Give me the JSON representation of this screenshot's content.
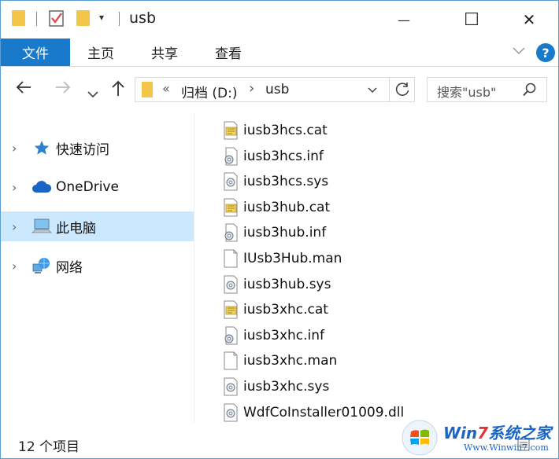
{
  "window": {
    "title": "usb",
    "minimize_glyph": "—",
    "maximize_glyph": "☐",
    "close_glyph": "✕"
  },
  "ribbon": {
    "file_tab": "文件",
    "tabs": [
      "主页",
      "共享",
      "查看"
    ],
    "help": "?"
  },
  "address": {
    "overflow": "«",
    "crumbs": [
      "归档 (D:)",
      "usb"
    ],
    "search_placeholder": "搜索\"usb\""
  },
  "sidebar": {
    "items": [
      {
        "label": "快速访问",
        "icon": "star-icon"
      },
      {
        "label": "OneDrive",
        "icon": "cloud-icon"
      },
      {
        "label": "此电脑",
        "icon": "computer-icon",
        "selected": true
      },
      {
        "label": "网络",
        "icon": "network-icon"
      }
    ]
  },
  "files": [
    {
      "name": "iusb3hcs.cat",
      "type": "cat"
    },
    {
      "name": "iusb3hcs.inf",
      "type": "inf"
    },
    {
      "name": "iusb3hcs.sys",
      "type": "sys"
    },
    {
      "name": "iusb3hub.cat",
      "type": "cat"
    },
    {
      "name": "iusb3hub.inf",
      "type": "inf"
    },
    {
      "name": "IUsb3Hub.man",
      "type": "man"
    },
    {
      "name": "iusb3hub.sys",
      "type": "sys"
    },
    {
      "name": "iusb3xhc.cat",
      "type": "cat"
    },
    {
      "name": "iusb3xhc.inf",
      "type": "inf"
    },
    {
      "name": "iusb3xhc.man",
      "type": "man"
    },
    {
      "name": "iusb3xhc.sys",
      "type": "sys"
    },
    {
      "name": "WdfCoInstaller01009.dll",
      "type": "dll"
    }
  ],
  "status": {
    "item_count": "12 个项目"
  },
  "watermark": {
    "brand_prefix": "Win",
    "brand_num": "7",
    "brand_suffix": "系统之家",
    "url": "Www.Winwin7.com"
  },
  "colors": {
    "accent": "#1979ca",
    "selection": "#cce8ff",
    "folder": "#f3c64a"
  }
}
